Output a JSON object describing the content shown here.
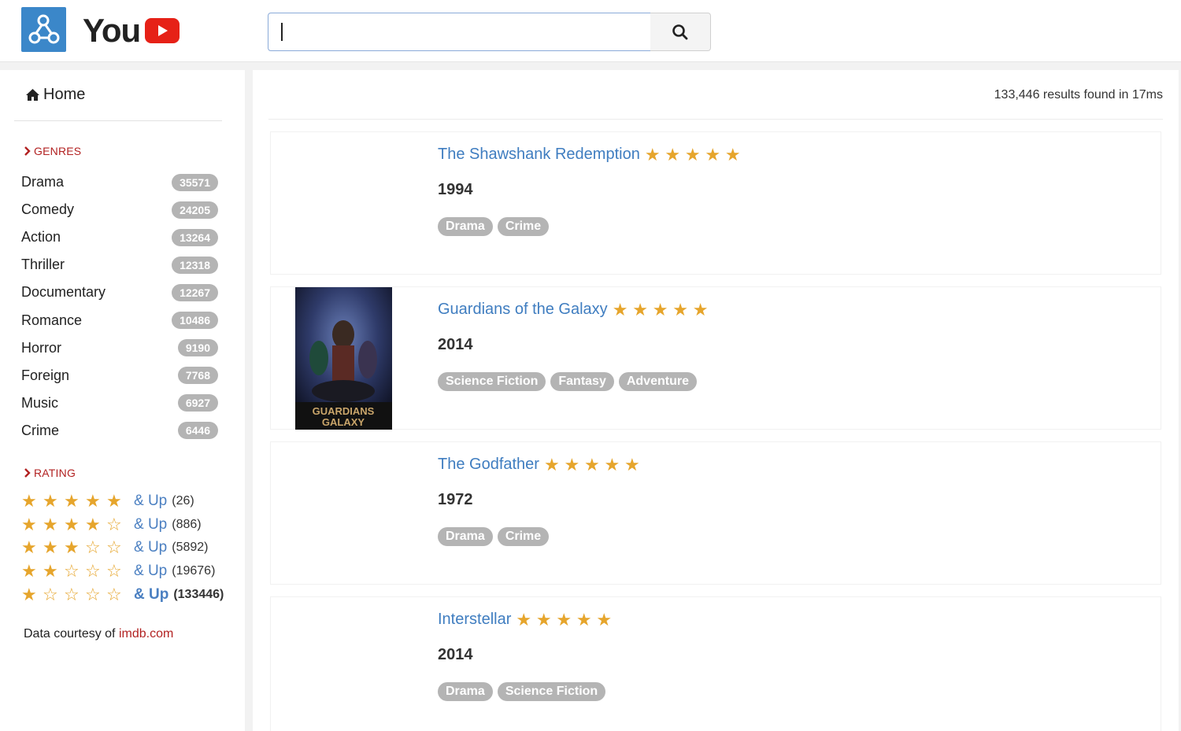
{
  "header": {
    "brand": "You",
    "search_value": "",
    "search_placeholder": ""
  },
  "sidebar": {
    "home_label": "Home",
    "genres_heading": "GENRES",
    "genres": [
      {
        "name": "Drama",
        "count": "35571"
      },
      {
        "name": "Comedy",
        "count": "24205"
      },
      {
        "name": "Action",
        "count": "13264"
      },
      {
        "name": "Thriller",
        "count": "12318"
      },
      {
        "name": "Documentary",
        "count": "12267"
      },
      {
        "name": "Romance",
        "count": "10486"
      },
      {
        "name": "Horror",
        "count": "9190"
      },
      {
        "name": "Foreign",
        "count": "7768"
      },
      {
        "name": "Music",
        "count": "6927"
      },
      {
        "name": "Crime",
        "count": "6446"
      }
    ],
    "rating_heading": "RATING",
    "ratings": [
      {
        "stars": 5,
        "label": "& Up",
        "count": "(26)"
      },
      {
        "stars": 4,
        "label": "& Up",
        "count": "(886)"
      },
      {
        "stars": 3,
        "label": "& Up",
        "count": "(5892)"
      },
      {
        "stars": 2,
        "label": "& Up",
        "count": "(19676)"
      },
      {
        "stars": 1,
        "label": "& Up",
        "count": "(133446)"
      }
    ],
    "courtesy_text": "Data courtesy of ",
    "courtesy_link": "imdb.com"
  },
  "main": {
    "results_info": "133,446 results found in 17ms",
    "movies": [
      {
        "title": "The Shawshank Redemption",
        "stars": 5,
        "year": "1994",
        "genres": [
          "Drama",
          "Crime"
        ],
        "poster": false
      },
      {
        "title": "Guardians of the Galaxy",
        "stars": 5,
        "year": "2014",
        "genres": [
          "Science Fiction",
          "Fantasy",
          "Adventure"
        ],
        "poster": true,
        "poster_text_1": "GUARDIANS",
        "poster_text_2": "GALAXY"
      },
      {
        "title": "The Godfather",
        "stars": 5,
        "year": "1972",
        "genres": [
          "Drama",
          "Crime"
        ],
        "poster": false
      },
      {
        "title": "Interstellar",
        "stars": 5,
        "year": "2014",
        "genres": [
          "Drama",
          "Science Fiction"
        ],
        "poster": false
      }
    ]
  },
  "colors": {
    "accent_blue": "#3f7dc0",
    "star": "#e6a52c",
    "heading_red": "#b22222",
    "badge_gray": "#b4b4b4",
    "logo_blue": "#3b87c9",
    "yt_red": "#e62117"
  },
  "icons": {
    "logo": "molecule-icon",
    "yt": "play-icon",
    "search": "search-icon",
    "home": "home-icon",
    "chevron": "chevron-right-icon",
    "star": "star-icon"
  }
}
